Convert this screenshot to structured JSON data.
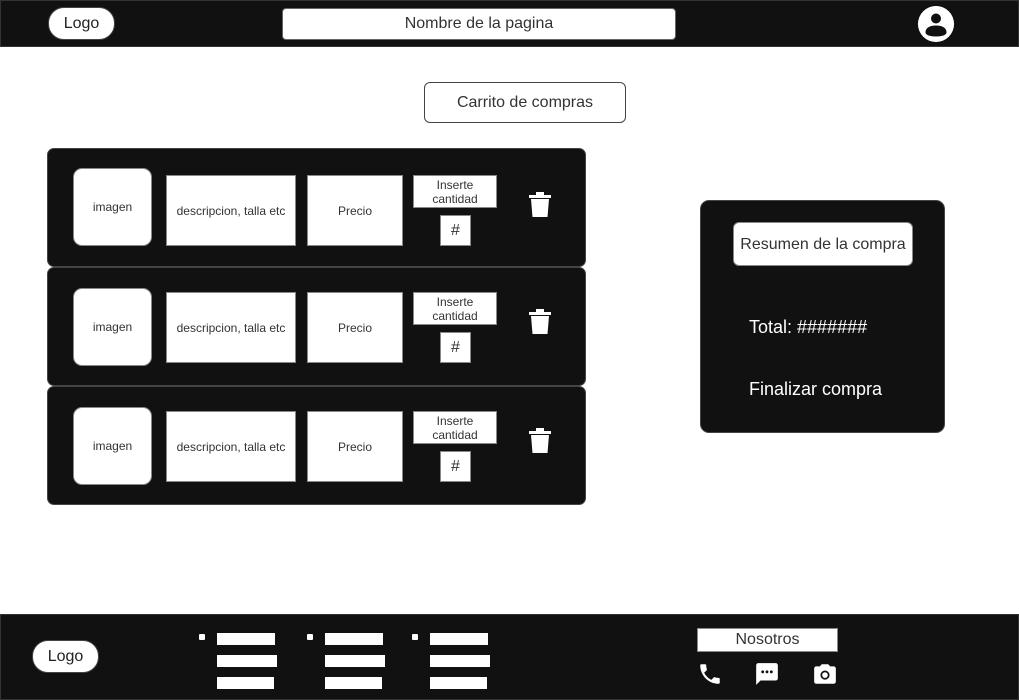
{
  "header": {
    "logo": "Logo",
    "page_name": "Nombre de la pagina",
    "avatar_icon": "user-avatar-icon"
  },
  "cart": {
    "title": "Carrito de compras",
    "items": [
      {
        "image": "imagen",
        "description": "descripcion, talla etc",
        "price": "Precio",
        "qty_label": "Inserte cantidad",
        "qty_value": "#",
        "delete_icon": "trash-icon"
      },
      {
        "image": "imagen",
        "description": "descripcion, talla etc",
        "price": "Precio",
        "qty_label": "Inserte cantidad",
        "qty_value": "#",
        "delete_icon": "trash-icon"
      },
      {
        "image": "imagen",
        "description": "descripcion, talla etc",
        "price": "Precio",
        "qty_label": "Inserte cantidad",
        "qty_value": "#",
        "delete_icon": "trash-icon"
      }
    ]
  },
  "summary": {
    "title": "Resumen de la compra",
    "total": "Total: #######",
    "checkout": "Finalizar compra"
  },
  "footer": {
    "logo": "Logo",
    "nosotros": "Nosotros",
    "icons": [
      "phone-icon",
      "chat-icon",
      "camera-icon"
    ]
  },
  "colors": {
    "dark_panel": "#111111",
    "light_box": "#ffffff"
  }
}
